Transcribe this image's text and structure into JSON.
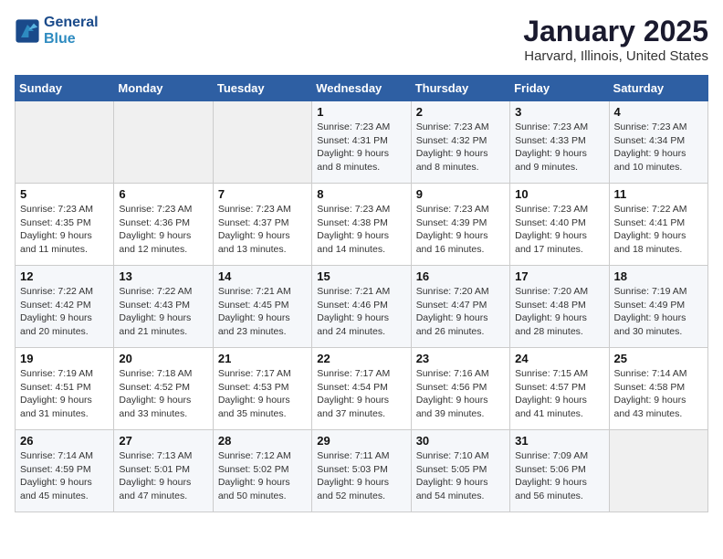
{
  "header": {
    "logo_line1": "General",
    "logo_line2": "Blue",
    "title": "January 2025",
    "subtitle": "Harvard, Illinois, United States"
  },
  "weekdays": [
    "Sunday",
    "Monday",
    "Tuesday",
    "Wednesday",
    "Thursday",
    "Friday",
    "Saturday"
  ],
  "weeks": [
    [
      {
        "day": "",
        "info": ""
      },
      {
        "day": "",
        "info": ""
      },
      {
        "day": "",
        "info": ""
      },
      {
        "day": "1",
        "info": "Sunrise: 7:23 AM\nSunset: 4:31 PM\nDaylight: 9 hours and 8 minutes."
      },
      {
        "day": "2",
        "info": "Sunrise: 7:23 AM\nSunset: 4:32 PM\nDaylight: 9 hours and 8 minutes."
      },
      {
        "day": "3",
        "info": "Sunrise: 7:23 AM\nSunset: 4:33 PM\nDaylight: 9 hours and 9 minutes."
      },
      {
        "day": "4",
        "info": "Sunrise: 7:23 AM\nSunset: 4:34 PM\nDaylight: 9 hours and 10 minutes."
      }
    ],
    [
      {
        "day": "5",
        "info": "Sunrise: 7:23 AM\nSunset: 4:35 PM\nDaylight: 9 hours and 11 minutes."
      },
      {
        "day": "6",
        "info": "Sunrise: 7:23 AM\nSunset: 4:36 PM\nDaylight: 9 hours and 12 minutes."
      },
      {
        "day": "7",
        "info": "Sunrise: 7:23 AM\nSunset: 4:37 PM\nDaylight: 9 hours and 13 minutes."
      },
      {
        "day": "8",
        "info": "Sunrise: 7:23 AM\nSunset: 4:38 PM\nDaylight: 9 hours and 14 minutes."
      },
      {
        "day": "9",
        "info": "Sunrise: 7:23 AM\nSunset: 4:39 PM\nDaylight: 9 hours and 16 minutes."
      },
      {
        "day": "10",
        "info": "Sunrise: 7:23 AM\nSunset: 4:40 PM\nDaylight: 9 hours and 17 minutes."
      },
      {
        "day": "11",
        "info": "Sunrise: 7:22 AM\nSunset: 4:41 PM\nDaylight: 9 hours and 18 minutes."
      }
    ],
    [
      {
        "day": "12",
        "info": "Sunrise: 7:22 AM\nSunset: 4:42 PM\nDaylight: 9 hours and 20 minutes."
      },
      {
        "day": "13",
        "info": "Sunrise: 7:22 AM\nSunset: 4:43 PM\nDaylight: 9 hours and 21 minutes."
      },
      {
        "day": "14",
        "info": "Sunrise: 7:21 AM\nSunset: 4:45 PM\nDaylight: 9 hours and 23 minutes."
      },
      {
        "day": "15",
        "info": "Sunrise: 7:21 AM\nSunset: 4:46 PM\nDaylight: 9 hours and 24 minutes."
      },
      {
        "day": "16",
        "info": "Sunrise: 7:20 AM\nSunset: 4:47 PM\nDaylight: 9 hours and 26 minutes."
      },
      {
        "day": "17",
        "info": "Sunrise: 7:20 AM\nSunset: 4:48 PM\nDaylight: 9 hours and 28 minutes."
      },
      {
        "day": "18",
        "info": "Sunrise: 7:19 AM\nSunset: 4:49 PM\nDaylight: 9 hours and 30 minutes."
      }
    ],
    [
      {
        "day": "19",
        "info": "Sunrise: 7:19 AM\nSunset: 4:51 PM\nDaylight: 9 hours and 31 minutes."
      },
      {
        "day": "20",
        "info": "Sunrise: 7:18 AM\nSunset: 4:52 PM\nDaylight: 9 hours and 33 minutes."
      },
      {
        "day": "21",
        "info": "Sunrise: 7:17 AM\nSunset: 4:53 PM\nDaylight: 9 hours and 35 minutes."
      },
      {
        "day": "22",
        "info": "Sunrise: 7:17 AM\nSunset: 4:54 PM\nDaylight: 9 hours and 37 minutes."
      },
      {
        "day": "23",
        "info": "Sunrise: 7:16 AM\nSunset: 4:56 PM\nDaylight: 9 hours and 39 minutes."
      },
      {
        "day": "24",
        "info": "Sunrise: 7:15 AM\nSunset: 4:57 PM\nDaylight: 9 hours and 41 minutes."
      },
      {
        "day": "25",
        "info": "Sunrise: 7:14 AM\nSunset: 4:58 PM\nDaylight: 9 hours and 43 minutes."
      }
    ],
    [
      {
        "day": "26",
        "info": "Sunrise: 7:14 AM\nSunset: 4:59 PM\nDaylight: 9 hours and 45 minutes."
      },
      {
        "day": "27",
        "info": "Sunrise: 7:13 AM\nSunset: 5:01 PM\nDaylight: 9 hours and 47 minutes."
      },
      {
        "day": "28",
        "info": "Sunrise: 7:12 AM\nSunset: 5:02 PM\nDaylight: 9 hours and 50 minutes."
      },
      {
        "day": "29",
        "info": "Sunrise: 7:11 AM\nSunset: 5:03 PM\nDaylight: 9 hours and 52 minutes."
      },
      {
        "day": "30",
        "info": "Sunrise: 7:10 AM\nSunset: 5:05 PM\nDaylight: 9 hours and 54 minutes."
      },
      {
        "day": "31",
        "info": "Sunrise: 7:09 AM\nSunset: 5:06 PM\nDaylight: 9 hours and 56 minutes."
      },
      {
        "day": "",
        "info": ""
      }
    ]
  ]
}
